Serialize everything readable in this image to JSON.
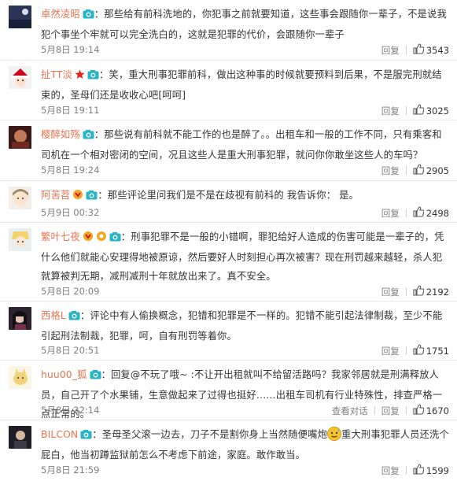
{
  "comments": [
    {
      "user": "卓然凌昭",
      "text": "：那些给有前科洗地的，你犯事之前就要知道，这些事会跟随你一辈子，不是说我犯个事坐个牢就可以完全洗白的，这就是犯罪的代价，会跟随你一辈子",
      "date": "5月8日 19:14",
      "reply": "回复",
      "likes": "3543",
      "has_report": false,
      "extra_icon": "none"
    },
    {
      "user": "扯TT淡",
      "text": "：笑，重大刑事犯罪前科，做出这种事的时候就要预料到后果，不是服完刑就结束的，圣母们还是收收心吧[呵呵]",
      "date": "5月8日 19:11",
      "reply": "回复",
      "likes": "3025",
      "has_report": false,
      "extra_icon": "star"
    },
    {
      "user": "樱醉如殇",
      "text": "：那些说有前科就不能工作的也是醉了。。出租车和一般的工作不同，只有乘客和司机在一个相对密闭的空间，况且这些人是重大刑事犯罪，就问你你敢坐这些人的车吗？",
      "date": "5月8日 19:24",
      "reply": "回复",
      "likes": "2905",
      "has_report": false,
      "extra_icon": "none"
    },
    {
      "user": "阿苦苕",
      "text": "：那些评论里问我们是不是在歧视有前科的 我告诉你： 是。",
      "date": "5月9日 00:32",
      "reply": "回复",
      "likes": "2498",
      "has_report": false,
      "extra_icon": "badge"
    },
    {
      "user": "繁叶七夜",
      "text": "：刑事犯罪不是一般的小错啊，罪犯给好人造成的伤害可能是一辈子的，凭什么他们就能心安理得地被原谅，然后要好人时刻担心再次被害？现在刑罚越来越轻，杀人犯就算被判无期，减刑减刑十年就放出来了。真不安全。",
      "date": "5月8日 20:09",
      "reply": "回复",
      "likes": "2192",
      "has_report": false,
      "extra_icon": "badge2"
    },
    {
      "user": "西格L",
      "text": "：评论中有人偷换概念，犯错和犯罪是不一样的。犯错不能引起法律制裁，至少不能引起刑法制裁，犯罪，呵，自有刑罚等着你。",
      "date": "5月8日 20:51",
      "reply": "回复",
      "likes": "1751",
      "has_report": false,
      "extra_icon": "none"
    },
    {
      "user": "huu00_狐",
      "text": "：回复@不玩了哦~ :不让开出租就叫不给留活路吗？我家邻居就是刑满释放人员，自己开了个水果铺，生意做起来了过得也挺好……出租车司机有行业特殊性，排查严格一点正常的。",
      "date": "5月8日 22:14",
      "report": "查看对话",
      "reply": "回复",
      "likes": "1670",
      "has_report": true,
      "extra_icon": "none"
    },
    {
      "user": "BILCON",
      "text_a": "：圣母圣父滚一边去，刀子不是割你身上当然随便嘴炮",
      "text_b": "重大刑事犯罪人员还洗个屁白，他当初蹲监狱前怎么不考虑下前途，家庭。敢作敢当。",
      "date": "5月8日 21:59",
      "reply": "回复",
      "likes": "1599",
      "has_report": false,
      "extra_icon": "none"
    }
  ],
  "colors": {
    "username": "#eb7350",
    "vip_camera": "#27b5c6",
    "meta": "#808080",
    "divider": "#eaeaea"
  }
}
